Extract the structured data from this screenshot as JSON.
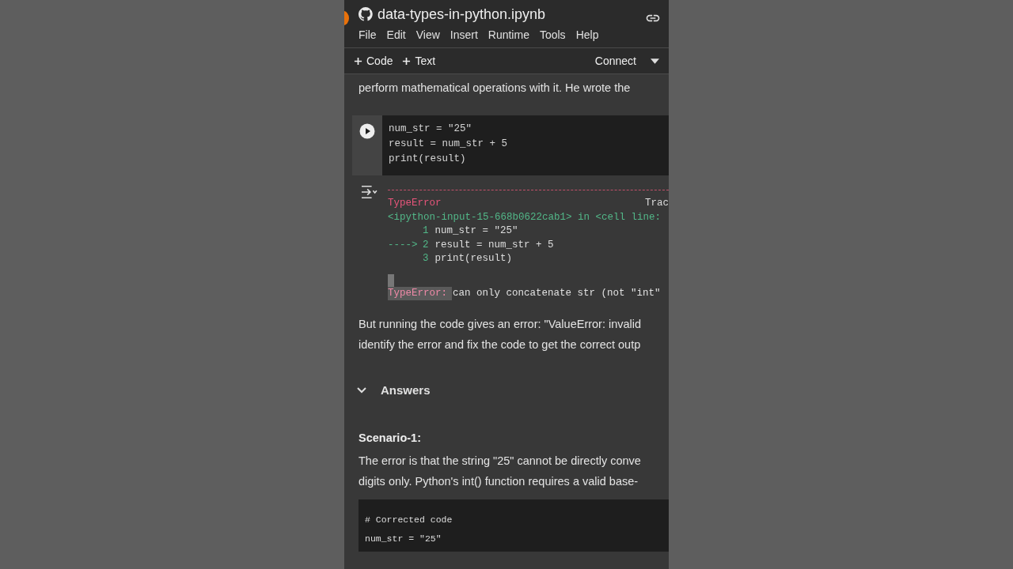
{
  "header": {
    "title": "data-types-in-python.ipynb",
    "menu": [
      "File",
      "Edit",
      "View",
      "Insert",
      "Runtime",
      "Tools",
      "Help"
    ]
  },
  "toolbar": {
    "add_buttons": [
      "Code",
      "Text"
    ],
    "connect": "Connect"
  },
  "cells": [
    {
      "kind": "text",
      "lines": [
        "perform mathematical operations with it. He wrote the"
      ]
    },
    {
      "kind": "code",
      "lines": [
        "num_str = \"25\"",
        "result = num_str + 5",
        "print(result)"
      ],
      "output": {
        "error_name": "TypeError",
        "trace_right": "Trac",
        "location": "<ipython-input-15-668b0622cab1> in <cell line:",
        "frames": [
          {
            "num": "1",
            "code": "num_str = \"25\""
          },
          {
            "prefix": "---->",
            "num": "2",
            "code": "result = num_str + 5"
          },
          {
            "num": "3",
            "code": "print(result)"
          }
        ],
        "message_label": "TypeError:",
        "message": "can only concatenate str (not \"int\""
      }
    },
    {
      "kind": "text",
      "lines": [
        "But running the code gives an error: \"ValueError: invalid",
        "identify the error and fix the code to get the correct outp"
      ]
    },
    {
      "kind": "section",
      "title": "Answers",
      "expanded": true
    },
    {
      "kind": "heading",
      "text": "Scenario-1:"
    },
    {
      "kind": "text",
      "lines": [
        "The error is that the string \"25\" cannot be directly conve",
        "digits only. Python's int() function requires a valid base-"
      ]
    },
    {
      "kind": "code_block",
      "lines": [
        "# Corrected code",
        "num_str = \"25\""
      ]
    }
  ]
}
